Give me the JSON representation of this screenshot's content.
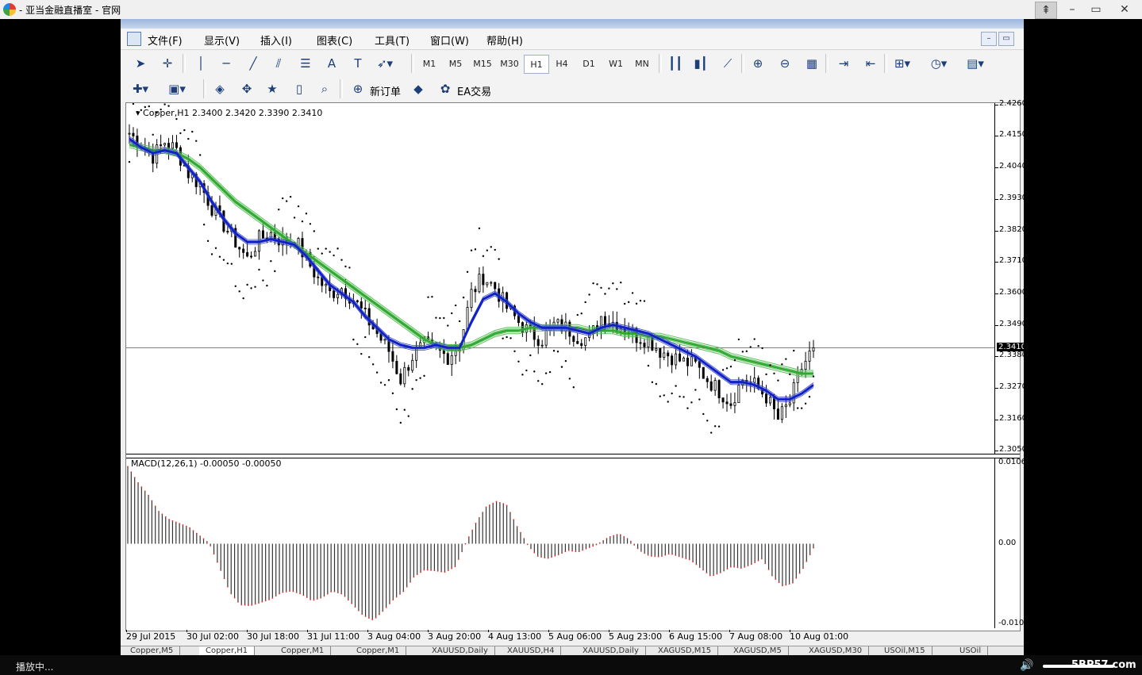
{
  "player": {
    "title": "- 亚当金融直播室 - 官网",
    "controls": [
      "⇞",
      "–",
      "▭",
      "✕"
    ],
    "status": "播放中...",
    "watermark": "5BP57.com"
  },
  "mt4": {
    "menu": [
      "文件(F)",
      "显示(V)",
      "插入(I)",
      "图表(C)",
      "工具(T)",
      "窗口(W)",
      "帮助(H)"
    ],
    "timeframes": [
      "M1",
      "M5",
      "M15",
      "M30",
      "H1",
      "H4",
      "D1",
      "W1",
      "MN"
    ],
    "active_timeframe": "H1",
    "toolbar2": {
      "new_order": "新订单",
      "ea_trade": "EA交易"
    },
    "symbol_info": "Copper,H1  2.3400 2.3420 2.3390 2.3410",
    "macd_info": "MACD(12,26,1) -0.00050 -0.00050",
    "current_price": "2.3410",
    "tabs": [
      "Copper,M5",
      "Copper,H1",
      "Copper,M1",
      "Copper,M1",
      "XAUUSD,Daily",
      "XAUUSD,H4",
      "XAUUSD,Daily",
      "XAGUSD,M15",
      "XAGUSD,M5",
      "XAGUSD,M30",
      "USOil,M15",
      "USOil"
    ]
  },
  "chart_data": [
    {
      "type": "candlestick",
      "symbol": "Copper",
      "timeframe": "H1",
      "y_ticks": [
        "2.4260",
        "2.4150",
        "2.4040",
        "2.3930",
        "2.3820",
        "2.3710",
        "2.3600",
        "2.3490",
        "2.3380",
        "2.3270",
        "2.3160",
        "2.3050"
      ],
      "ylim": [
        2.304,
        2.4265
      ],
      "x_labels": [
        "29 Jul 2015",
        "30 Jul 02:00",
        "30 Jul 18:00",
        "31 Jul 11:00",
        "3 Aug 04:00",
        "3 Aug 20:00",
        "4 Aug 13:00",
        "5 Aug 06:00",
        "5 Aug 23:00",
        "6 Aug 15:00",
        "7 Aug 08:00",
        "10 Aug 01:00"
      ],
      "close_path": [
        2.416,
        2.412,
        2.408,
        2.413,
        2.41,
        2.402,
        2.398,
        2.39,
        2.384,
        2.378,
        2.372,
        2.379,
        2.381,
        2.378,
        2.379,
        2.372,
        2.365,
        2.36,
        2.362,
        2.358,
        2.352,
        2.346,
        2.34,
        2.33,
        2.338,
        2.342,
        2.34,
        2.338,
        2.342,
        2.36,
        2.366,
        2.362,
        2.355,
        2.35,
        2.346,
        2.344,
        2.349,
        2.348,
        2.345,
        2.344,
        2.352,
        2.35,
        2.348,
        2.345,
        2.344,
        2.34,
        2.338,
        2.336,
        2.335,
        2.33,
        2.326,
        2.322,
        2.33,
        2.328,
        2.324,
        2.316,
        2.322,
        2.334,
        2.341
      ],
      "ema_fast": [
        2.414,
        2.411,
        2.409,
        2.41,
        2.409,
        2.404,
        2.399,
        2.392,
        2.386,
        2.381,
        2.378,
        2.378,
        2.379,
        2.378,
        2.377,
        2.373,
        2.368,
        2.363,
        2.36,
        2.357,
        2.352,
        2.348,
        2.344,
        2.342,
        2.341,
        2.341,
        2.342,
        2.341,
        2.341,
        2.35,
        2.358,
        2.36,
        2.357,
        2.353,
        2.35,
        2.348,
        2.348,
        2.348,
        2.347,
        2.346,
        2.348,
        2.349,
        2.348,
        2.347,
        2.346,
        2.344,
        2.342,
        2.34,
        2.338,
        2.335,
        2.332,
        2.329,
        2.329,
        2.328,
        2.326,
        2.323,
        2.323,
        2.325,
        2.328
      ],
      "ema_slow": [
        2.412,
        2.411,
        2.41,
        2.41,
        2.409,
        2.407,
        2.404,
        2.4,
        2.396,
        2.392,
        2.389,
        2.386,
        2.383,
        2.38,
        2.377,
        2.374,
        2.371,
        2.368,
        2.365,
        2.362,
        2.359,
        2.356,
        2.353,
        2.35,
        2.347,
        2.344,
        2.342,
        2.341,
        2.341,
        2.342,
        2.344,
        2.346,
        2.347,
        2.347,
        2.348,
        2.348,
        2.348,
        2.348,
        2.348,
        2.347,
        2.347,
        2.347,
        2.346,
        2.346,
        2.345,
        2.345,
        2.344,
        2.343,
        2.342,
        2.341,
        2.34,
        2.338,
        2.337,
        2.336,
        2.335,
        2.334,
        2.333,
        2.332,
        2.332
      ]
    },
    {
      "type": "bar",
      "name": "MACD(12,26,1)",
      "y_ticks": [
        "0.0106",
        "0.00",
        "-0.010"
      ],
      "ylim": [
        -0.0104,
        0.0106
      ],
      "values": [
        0.0095,
        0.0075,
        0.006,
        0.004,
        0.003,
        0.0025,
        0.002,
        0.001,
        0.0,
        -0.003,
        -0.006,
        -0.0075,
        -0.0076,
        -0.0072,
        -0.0068,
        -0.006,
        -0.0058,
        -0.0062,
        -0.007,
        -0.0066,
        -0.0058,
        -0.0062,
        -0.0075,
        -0.0088,
        -0.0094,
        -0.0082,
        -0.0068,
        -0.0058,
        -0.004,
        -0.0032,
        -0.0033,
        -0.0035,
        -0.0028,
        0.0,
        0.0025,
        0.0045,
        0.0052,
        0.0048,
        0.0022,
        0.0,
        -0.0015,
        -0.0018,
        -0.0014,
        -0.0008,
        -0.001,
        -0.0005,
        0.0,
        0.0008,
        0.0012,
        0.0005,
        -0.0008,
        -0.0015,
        -0.0016,
        -0.0012,
        -0.0016,
        -0.002,
        -0.003,
        -0.004,
        -0.0035,
        -0.0028,
        -0.003,
        -0.0025,
        -0.0018,
        -0.004,
        -0.0052,
        -0.0048,
        -0.003,
        -0.0005
      ]
    }
  ]
}
